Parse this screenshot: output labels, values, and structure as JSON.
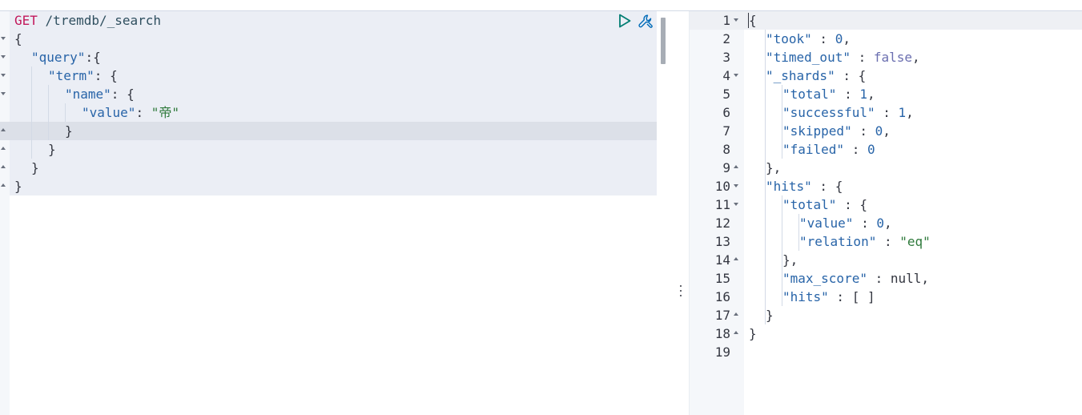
{
  "request": {
    "method": "GET",
    "path": "/tremdb/_search",
    "lines": [
      {
        "t1": "{"
      },
      {
        "key": "\"query\"",
        "t2": ":{"
      },
      {
        "key": "\"term\"",
        "t2": ": {"
      },
      {
        "key": "\"name\"",
        "t2": ": {"
      },
      {
        "key": "\"value\"",
        "t2": ": ",
        "val": "\"帝\""
      },
      {
        "t1": "}"
      },
      {
        "t1": "}"
      },
      {
        "t1": "}"
      },
      {
        "t1": "}"
      }
    ],
    "run_icon": "play-icon",
    "settings_icon": "wrench-icon"
  },
  "response": {
    "line_numbers": [
      "1",
      "2",
      "3",
      "4",
      "5",
      "6",
      "7",
      "8",
      "9",
      "10",
      "11",
      "12",
      "13",
      "14",
      "15",
      "16",
      "17",
      "18",
      "19"
    ],
    "lines": {
      "l1": "{",
      "l2k": "\"took\"",
      "l2s": " : ",
      "l2v": "0",
      "l2e": ",",
      "l3k": "\"timed_out\"",
      "l3s": " : ",
      "l3v": "false",
      "l3e": ",",
      "l4k": "\"_shards\"",
      "l4e": " : {",
      "l5k": "\"total\"",
      "l5s": " : ",
      "l5v": "1",
      "l5e": ",",
      "l6k": "\"successful\"",
      "l6s": " : ",
      "l6v": "1",
      "l6e": ",",
      "l7k": "\"skipped\"",
      "l7s": " : ",
      "l7v": "0",
      "l7e": ",",
      "l8k": "\"failed\"",
      "l8s": " : ",
      "l8v": "0",
      "l9": "},",
      "l10k": "\"hits\"",
      "l10e": " : {",
      "l11k": "\"total\"",
      "l11e": " : {",
      "l12k": "\"value\"",
      "l12s": " : ",
      "l12v": "0",
      "l12e": ",",
      "l13k": "\"relation\"",
      "l13s": " : ",
      "l13v": "\"eq\"",
      "l14": "},",
      "l15k": "\"max_score\"",
      "l15e": " : null,",
      "l16k": "\"hits\"",
      "l16e": " : [ ]",
      "l17": "}",
      "l18": "}"
    }
  }
}
